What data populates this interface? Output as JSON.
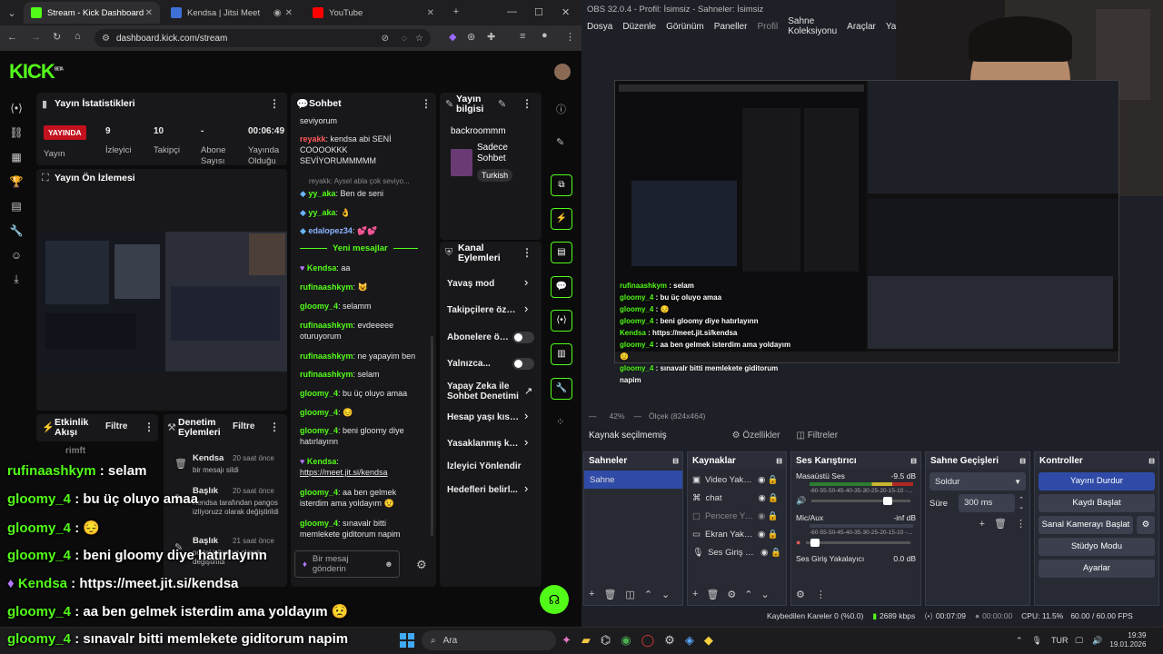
{
  "browser": {
    "tabs": [
      {
        "label": "Stream - Kick Dashboard",
        "color": "#53fc18"
      },
      {
        "label": "Kendsa | Jitsi Meet",
        "color": "#3d6fd6"
      },
      {
        "label": "YouTube",
        "color": "#ff0000"
      }
    ],
    "url": "dashboard.kick.com/stream"
  },
  "kick": {
    "logo": "KICK",
    "logo_sup": "BETA",
    "stats": {
      "title": "Yayın İstatistikleri",
      "badge": "YAYINDA",
      "values": [
        "9",
        "10",
        "-",
        "00:06:49"
      ],
      "labels": [
        "Yayın",
        "İzleyici",
        "Takipçi",
        "Abone Sayısı",
        "Yayında Olduğu"
      ]
    },
    "preview_title": "Yayın Ön İzlemesi",
    "activity": {
      "title": "Etkinlik Akışı",
      "filter": "Filtre"
    },
    "audit": {
      "title": "Denetim Eylemleri",
      "filter": "Filtre",
      "items": [
        {
          "who": "Kendsa",
          "when": "20 saat önce",
          "what": "bir mesajı sildi"
        },
        {
          "who": "Başlık",
          "when": "20 saat önce",
          "what": "Kendsa tarafından pangos izliyoruzz olarak değiştirildi"
        },
        {
          "who": "Başlık",
          "when": "21 saat önce",
          "what": "portal izliyoruz olarak değiştirildi"
        }
      ]
    },
    "chat": {
      "title": "Sohbet",
      "top_msg": "seviyorum",
      "reply_hint": "reyakk: Aysel abla çok seviyo...",
      "new_messages": "Yeni mesajlar",
      "messages": [
        {
          "user": "reyakk",
          "text": "kendsa abi SENİ COOOOKKK SEVİYORUMMMMM",
          "cls": "u-red"
        },
        {
          "user": "yy_aka",
          "text": "Ben de seni",
          "cls": "u-green"
        },
        {
          "user": "yy_aka",
          "text": "👌",
          "cls": "u-green"
        },
        {
          "user": "edalopez34",
          "text": "💕💕",
          "cls": "u-blue"
        },
        {
          "user": "Kendsa",
          "text": "aa",
          "cls": "u-green"
        },
        {
          "user": "rufinaashkym",
          "text": "😺",
          "cls": "u-green"
        },
        {
          "user": "gloomy_4",
          "text": "selamm",
          "cls": "u-green"
        },
        {
          "user": "rufinaashkym",
          "text": "evdeeeee oturuyorum",
          "cls": "u-green"
        },
        {
          "user": "rufinaashkym",
          "text": "ne yapayim ben",
          "cls": "u-green"
        },
        {
          "user": "rufinaashkym",
          "text": "selam",
          "cls": "u-green"
        },
        {
          "user": "gloomy_4",
          "text": "bu üç oluyo amaa",
          "cls": "u-green"
        },
        {
          "user": "gloomy_4",
          "text": "😔",
          "cls": "u-green"
        },
        {
          "user": "gloomy_4",
          "text": "beni gloomy diye hatırlayınn",
          "cls": "u-green"
        },
        {
          "user": "Kendsa",
          "text": "https://meet.jit.si/kendsa",
          "cls": "u-green"
        },
        {
          "user": "gloomy_4",
          "text": "aa ben gelmek isterdim ama yoldayım 😟",
          "cls": "u-green"
        },
        {
          "user": "gloomy_4",
          "text": "sınavalr bitti memlekete giditorum napim",
          "cls": "u-green"
        }
      ],
      "input_placeholder": "Bir mesaj gönderin"
    },
    "info": {
      "title": "Yayın bilgisi",
      "stream_title": "backroommm",
      "category": "Sadece Sohbet",
      "tag": "Turkish"
    },
    "mod": {
      "title": "Kanal Eylemleri",
      "rows": [
        "Yavaş mod",
        "Takipçilere özel so",
        "Abonelere öz...",
        "Yalnızca...",
        "Yapay Zeka ile Sohbet Denetimi",
        "Hesap yaşı kısıtla",
        "Yasaklanmış kelin",
        "İzleyici Yönlendir",
        "Hedefleri belirl..."
      ]
    }
  },
  "overlay": [
    {
      "user": "rufinaashkym",
      "text": " : selam"
    },
    {
      "user": "gloomy_4",
      "text": " : bu üç oluyo amaa"
    },
    {
      "user": "gloomy_4",
      "text": " : 😔"
    },
    {
      "user": "gloomy_4",
      "text": " : beni gloomy diye hatırlayınn"
    },
    {
      "user": "Kendsa",
      "text": " : https://meet.jit.si/kendsa"
    },
    {
      "user": "gloomy_4",
      "text": " : aa ben gelmek isterdim ama yoldayım 😟"
    },
    {
      "user": "gloomy_4",
      "text": " : sınavalr bitti memlekete giditorum napim"
    }
  ],
  "overlay_faded": "rimft",
  "obs": {
    "title": "OBS 32.0.4 - Profil: İsimsiz - Sahneler: İsimsiz",
    "menu": [
      "Dosya",
      "Düzenle",
      "Görünüm",
      "Paneller",
      "Profil",
      "Sahne Koleksiyonu",
      "Araçlar",
      "Yardı"
    ],
    "zoom": "42%",
    "scale": "Ölçek (824x464)",
    "no_source": "Kaynak seçilmemiş",
    "props": "Özellikler",
    "filters": "Filtreler",
    "scenes": {
      "title": "Sahneler",
      "items": [
        "Sahne"
      ]
    },
    "sources": {
      "title": "Kaynaklar",
      "items": [
        "Video Yakala",
        "chat",
        "Pencere Yaka",
        "Ekran Yakala",
        "Ses Giriş Yaka"
      ]
    },
    "mixer": {
      "title": "Ses Karıştırıcı",
      "channels": [
        {
          "name": "Masaüstü Ses",
          "db": "-9.5 dB"
        },
        {
          "name": "Mic/Aux",
          "db": "-inf dB"
        },
        {
          "name": "Ses Giriş Yakalayıcı",
          "db": "0.0 dB"
        }
      ],
      "scale": "-60-55-50-45-40-35-30-25-20-15-10 -5 0"
    },
    "transitions": {
      "title": "Sahne Geçişleri",
      "type": "Soldur",
      "duration_label": "Süre",
      "duration": "300 ms"
    },
    "controls": {
      "title": "Kontroller",
      "buttons": [
        "Yayını Durdur",
        "Kaydı Başlat",
        "Sanal Kamerayı Başlat",
        "Stüdyo Modu",
        "Ayarlar"
      ]
    },
    "status": {
      "dropped": "Kaybedilen Kareler 0 (%0.0)",
      "kbps": "2689 kbps",
      "stream_time": "00:07:09",
      "rec_time": "00:00:00",
      "cpu": "CPU: 11.5%",
      "fps": "60.00 / 60.00 FPS"
    }
  },
  "taskbar": {
    "search": "Ara",
    "lang": "TUR",
    "time": "19:39",
    "date": "19.01.2026"
  }
}
